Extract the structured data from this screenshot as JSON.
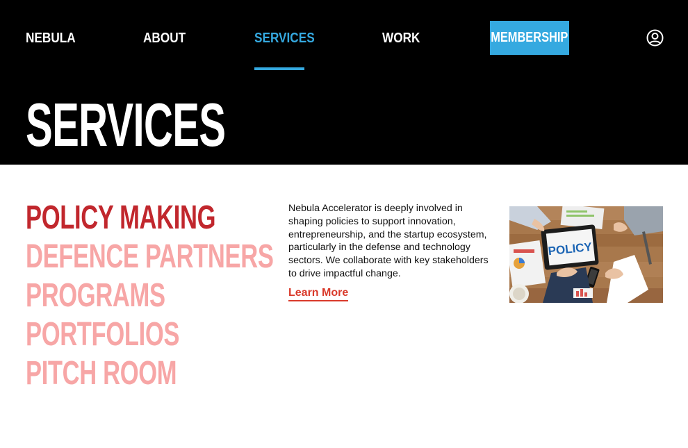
{
  "nav": {
    "brand": "NEBULA",
    "items": [
      {
        "label": "ABOUT"
      },
      {
        "label": "SERVICES",
        "active": true
      },
      {
        "label": "WORK"
      }
    ],
    "membership_label": "MEMBERSHIP",
    "profile_icon": "user-circle-icon"
  },
  "page": {
    "title": "SERVICES"
  },
  "services": {
    "items": [
      {
        "label": "POLICY MAKING",
        "active": true
      },
      {
        "label": "DEFENCE PARTNERS"
      },
      {
        "label": "PROGRAMS"
      },
      {
        "label": "PORTFOLIOS"
      },
      {
        "label": "PITCH ROOM"
      }
    ]
  },
  "detail": {
    "description": "Nebula Accelerator is deeply involved in shaping policies to support innovation, entrepreneurship, and the startup ecosystem, particularly in the defense and technology sectors. We collaborate with key stakeholders to drive impactful change.",
    "link_label": "Learn More",
    "image_caption": "POLICY"
  },
  "colors": {
    "header_bg": "#000000",
    "accent_blue": "#35a9e0",
    "active_red": "#c1272d",
    "inactive_pink": "#f7a6a6",
    "link_red": "#d93a2b"
  }
}
